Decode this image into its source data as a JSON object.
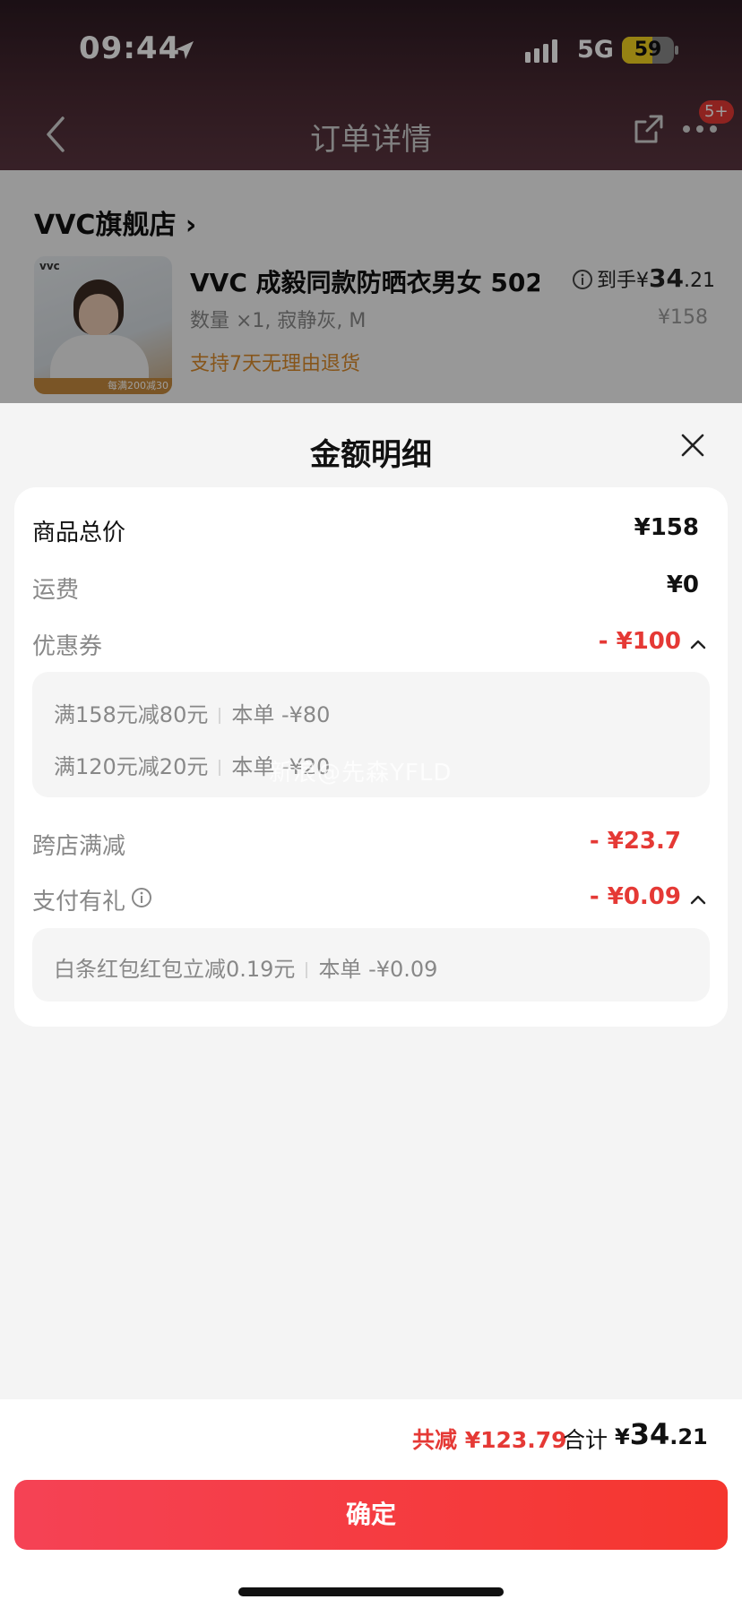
{
  "status_bar": {
    "time": "09:44",
    "network": "5G",
    "battery": "59",
    "battery_level": 0.59
  },
  "nav": {
    "title": "订单详情",
    "badge": "5+"
  },
  "order": {
    "store_name": "VVC旗舰店 ›",
    "product_title": "VVC 成毅同款防晒衣男女 502…",
    "spec": "数量 ×1, 寂静灰, M",
    "return_policy": "支持7天无理由退货",
    "price_label": "到手¥",
    "price_int": "34",
    "price_dec": ".21",
    "original_price": "¥158",
    "thumb_brand": "vvc",
    "thumb_promo": "每满200减30"
  },
  "sheet": {
    "title": "金额明细",
    "rows": {
      "goods_total": {
        "label": "商品总价",
        "amount": "¥158"
      },
      "shipping": {
        "label": "运费",
        "amount": "¥0"
      },
      "coupon": {
        "label": "优惠券",
        "amount": "- ¥100"
      },
      "cross_store": {
        "label": "跨店满减",
        "amount": "- ¥23.7"
      },
      "payment_gift": {
        "label": "支付有礼",
        "amount": "- ¥0.09"
      }
    },
    "coupon_details": [
      {
        "rule": "满158元减80元",
        "applied": "本单 -¥80"
      },
      {
        "rule": "满120元减20元",
        "applied": "本单 -¥20"
      }
    ],
    "payment_details": [
      {
        "rule": "白条红包红包立减0.19元",
        "applied": "本单 -¥0.09"
      }
    ],
    "watermark": "新浪@先森YFLD"
  },
  "footer": {
    "savings": "共减 ¥123.79",
    "total_label": "合计",
    "total_currency": "¥",
    "total_int": "34",
    "total_dec": ".21",
    "confirm": "确定"
  },
  "colors": {
    "accent_red": "#e53935",
    "confirm_gradient_start": "#f54255",
    "confirm_gradient_end": "#f5362e",
    "return_orange": "#d98a2b"
  }
}
